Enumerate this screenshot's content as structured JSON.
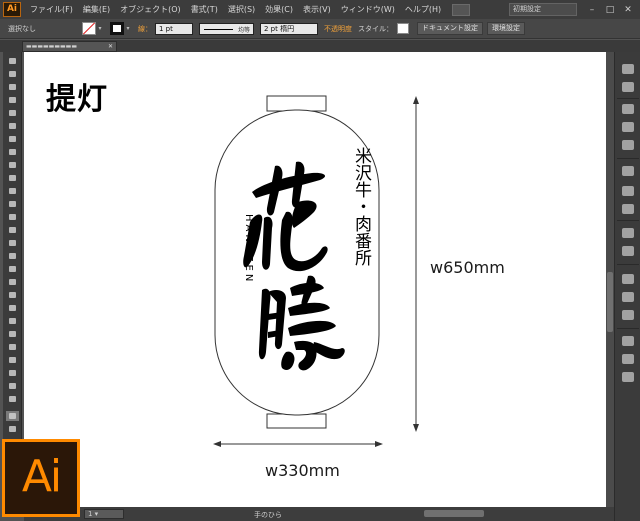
{
  "app": {
    "logo": "Ai",
    "menus": [
      "ファイル(F)",
      "編集(E)",
      "オブジェクト(O)",
      "書式(T)",
      "選択(S)",
      "効果(C)",
      "表示(V)",
      "ウィンドウ(W)",
      "ヘルプ(H)"
    ],
    "workspace": "初期設定"
  },
  "control": {
    "selection": "選択なし",
    "stroke_label": "線：",
    "stroke_weight": "1 pt",
    "stroke_style": "均等",
    "brush": "2 pt 楕円",
    "opacity_label": "不透明度",
    "style_label": "スタイル：",
    "doc_settings": "ドキュメント設定",
    "env_settings": "環境設定"
  },
  "status": {
    "mode": "手のひら"
  },
  "canvas": {
    "title": "提灯",
    "vertical_text": "米沢牛・肉番所",
    "romaji": "HANAZEN",
    "height_label": "w650mm",
    "width_label": "w330mm"
  },
  "badge": {
    "text": "Ai"
  },
  "colors": {
    "accent": "#ff8a00",
    "chrome": "#535353",
    "canvas": "#ffffff"
  }
}
